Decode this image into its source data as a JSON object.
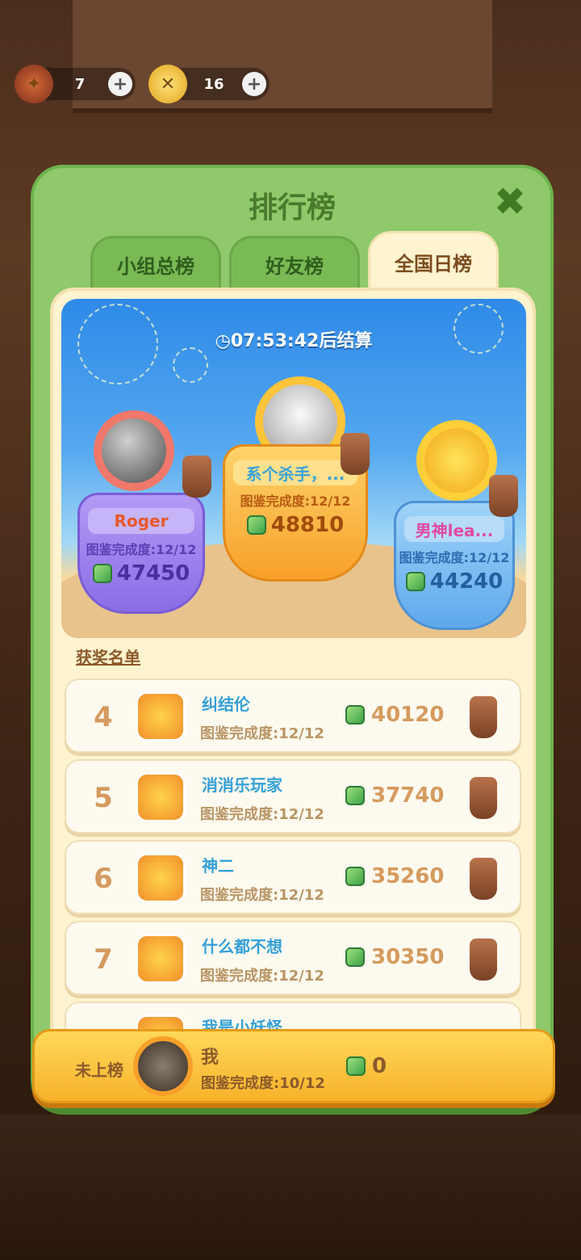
{
  "resources": [
    {
      "icon": "firecracker-icon",
      "value": "7",
      "plus": "+"
    },
    {
      "icon": "coin-icon",
      "value": "16",
      "plus": "+"
    }
  ],
  "modal": {
    "title": "排行榜",
    "close": "✖",
    "tabs": [
      {
        "label": "小组总榜",
        "active": false
      },
      {
        "label": "好友榜",
        "active": false
      },
      {
        "label": "全国日榜",
        "active": true
      }
    ]
  },
  "banner": {
    "timer": "07:53:42后结算",
    "podium": [
      {
        "rank": 2,
        "name": "Roger",
        "completion": "图鉴完成度:12/12",
        "score": "47450"
      },
      {
        "rank": 1,
        "name": "系个杀手，...",
        "completion": "图鉴完成度:12/12",
        "score": "48810"
      },
      {
        "rank": 3,
        "name": "男神lea...",
        "completion": "图鉴完成度:12/12",
        "score": "44240"
      }
    ]
  },
  "awards_title": "获奖名单",
  "ranking": [
    {
      "rank": "4",
      "name": "纠结伦",
      "completion": "图鉴完成度:12/12",
      "score": "40120"
    },
    {
      "rank": "5",
      "name": "消消乐玩家",
      "completion": "图鉴完成度:12/12",
      "score": "37740"
    },
    {
      "rank": "6",
      "name": "神二",
      "completion": "图鉴完成度:12/12",
      "score": "35260"
    },
    {
      "rank": "7",
      "name": "什么都不想",
      "completion": "图鉴完成度:12/12",
      "score": "30350"
    },
    {
      "rank": "",
      "name": "我是小妖怪...",
      "completion": "",
      "score": ""
    }
  ],
  "me": {
    "rank_label": "未上榜",
    "name": "我",
    "completion": "图鉴完成度:10/12",
    "score": "0"
  }
}
